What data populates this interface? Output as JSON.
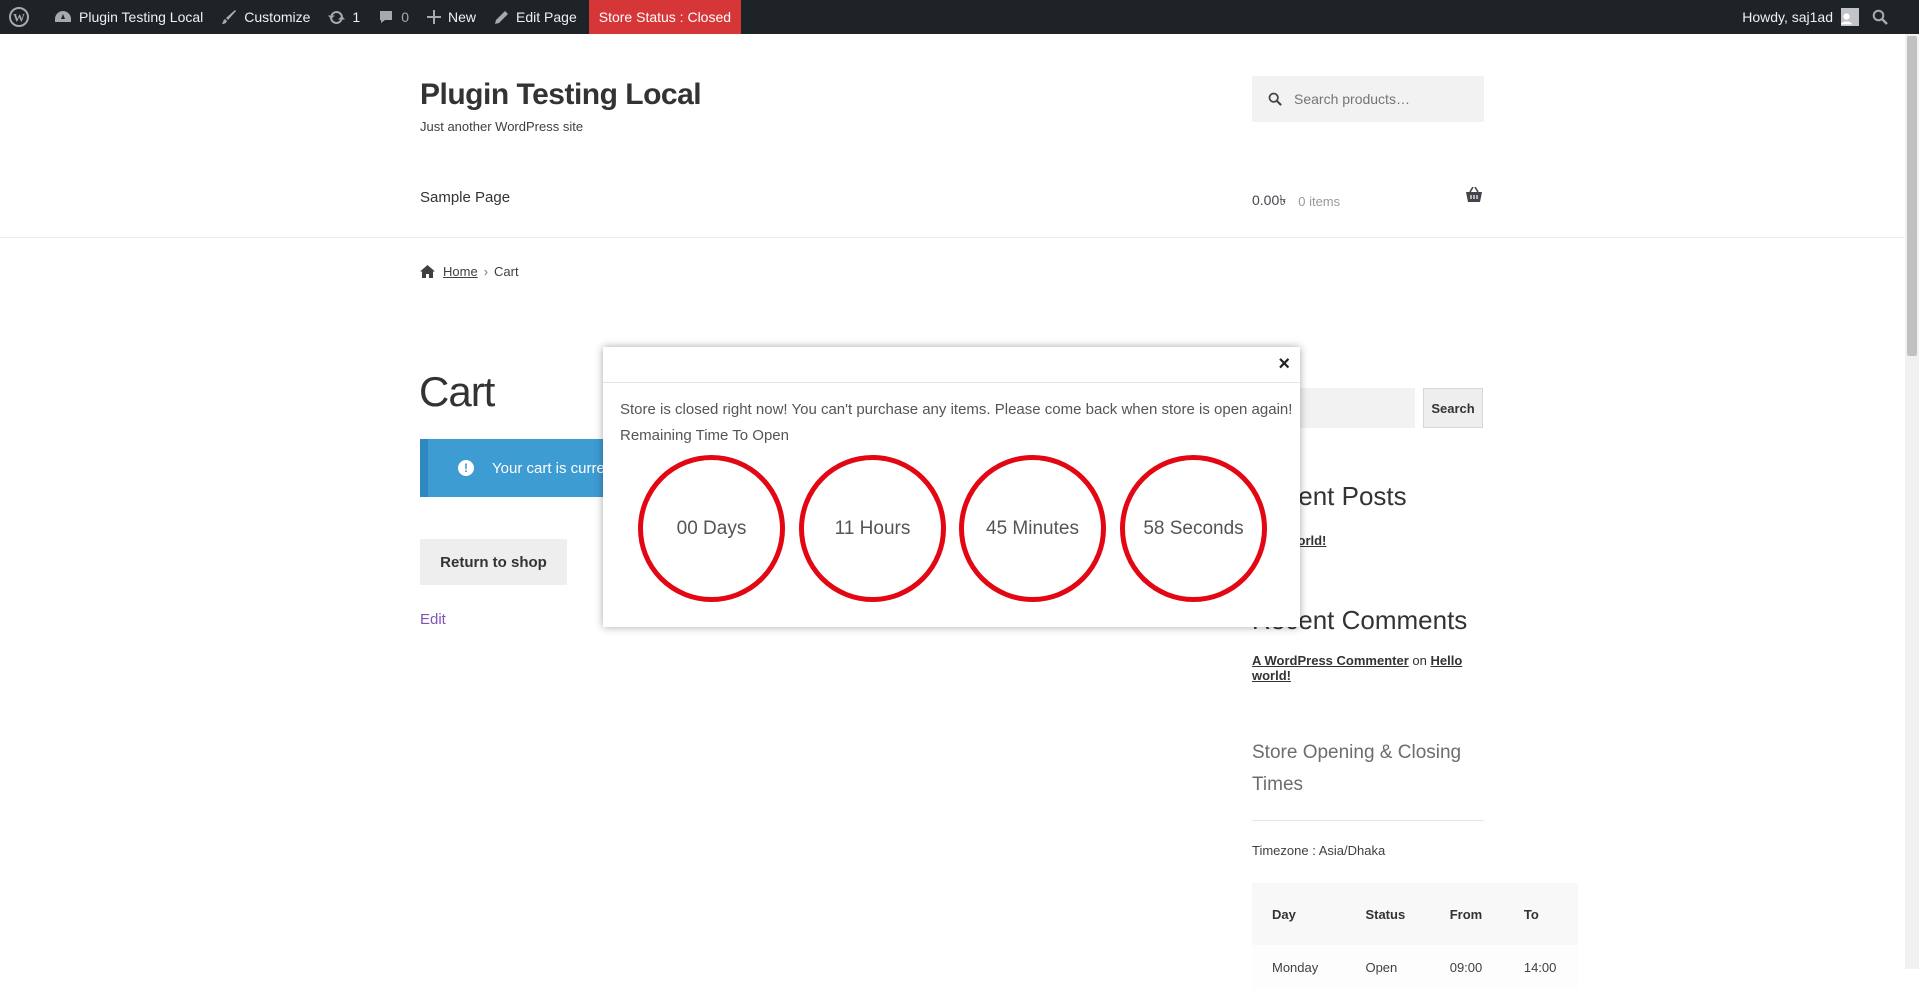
{
  "admin_bar": {
    "site_name": "Plugin Testing Local",
    "customize": "Customize",
    "updates_count": "1",
    "comments_count": "0",
    "new": "New",
    "edit_page": "Edit Page",
    "store_status": "Store Status : Closed",
    "howdy": "Howdy, saj1ad",
    "colors": {
      "background": "#1d2327",
      "status_bg": "#d63638"
    }
  },
  "header": {
    "site_title": "Plugin Testing Local",
    "tagline": "Just another WordPress site",
    "search_placeholder": "Search products…",
    "nav_item": "Sample Page",
    "cart_total": "0.00৳",
    "cart_items": "0 items"
  },
  "breadcrumb": {
    "home": "Home",
    "current": "Cart"
  },
  "main": {
    "page_title": "Cart",
    "notice_text": "Your cart is currently empty.",
    "return_button": "Return to shop",
    "edit_link": "Edit"
  },
  "sidebar": {
    "search_button": "Search",
    "recent_posts_heading": "Recent Posts",
    "recent_post": "Hello world!",
    "recent_comments_heading": "Recent Comments",
    "comment_author": "A WordPress Commenter",
    "comment_on": "on",
    "comment_post": "Hello world!",
    "hours_heading": "Store Opening & Closing Times",
    "timezone": "Timezone : Asia/Dhaka",
    "table_headers": [
      "Day",
      "Status",
      "From",
      "To"
    ],
    "table_rows": [
      [
        "Monday",
        "Open",
        "09:00",
        "14:00"
      ]
    ]
  },
  "modal": {
    "message": "Store is closed right now! You can't purchase any items. Please come back when store is open again!",
    "remaining_label": "Remaining Time To Open",
    "close_symbol": "×",
    "timers": [
      "00 Days",
      "11 Hours",
      "45 Minutes",
      "58 Seconds"
    ],
    "circle_color": "#e30613"
  }
}
